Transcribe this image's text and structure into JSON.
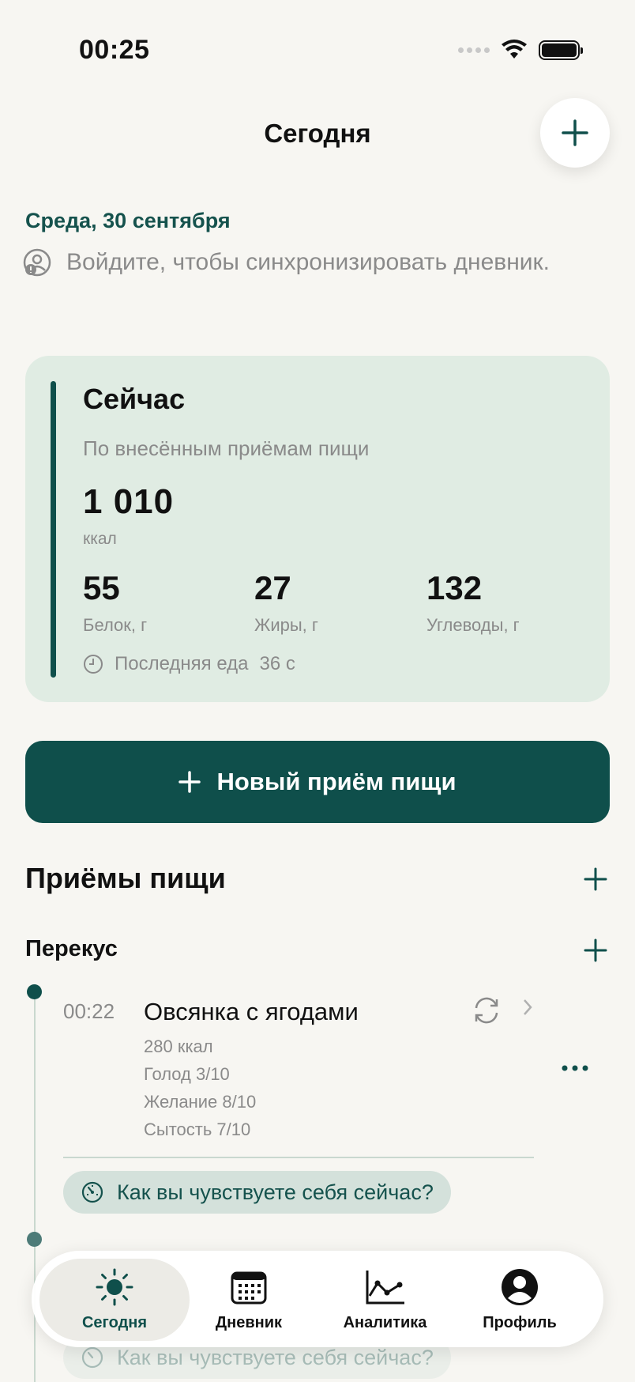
{
  "status_bar": {
    "time": "00:25"
  },
  "header": {
    "title": "Сегодня"
  },
  "date": "Среда, 30 сентября",
  "sync_prompt": "Войдите, чтобы синхронизировать дневник.",
  "now_card": {
    "title": "Сейчас",
    "subtitle": "По внесённым приёмам пищи",
    "kcal_value": "1 010",
    "kcal_unit": "ккал",
    "macros": [
      {
        "value": "55",
        "label": "Белок, г"
      },
      {
        "value": "27",
        "label": "Жиры, г"
      },
      {
        "value": "132",
        "label": "Углеводы, г"
      }
    ],
    "last_meal_label": "Последняя еда",
    "last_meal_value": "36 с"
  },
  "new_meal_button": "Новый приём пищи",
  "meals_section": {
    "title": "Приёмы пищи",
    "group_title": "Перекус",
    "items": [
      {
        "time": "00:22",
        "name": "Овсянка с ягодами",
        "kcal": "280 ккал",
        "hunger": "Голод 3/10",
        "desire": "Желание 8/10",
        "fullness": "Сытость 7/10",
        "feel_prompt": "Как вы чувствуете себя сейчас?"
      }
    ],
    "second_feel_prompt": "Как вы чувствуете себя сейчас?"
  },
  "tabbar": {
    "tabs": [
      {
        "label": "Сегодня",
        "icon": "sun-icon",
        "active": true
      },
      {
        "label": "Дневник",
        "icon": "calendar-icon",
        "active": false
      },
      {
        "label": "Аналитика",
        "icon": "chart-icon",
        "active": false
      },
      {
        "label": "Профиль",
        "icon": "profile-icon",
        "active": false
      }
    ]
  },
  "colors": {
    "accent": "#0f4f4b",
    "card_bg": "#e0ece3",
    "background": "#f7f6f2"
  }
}
